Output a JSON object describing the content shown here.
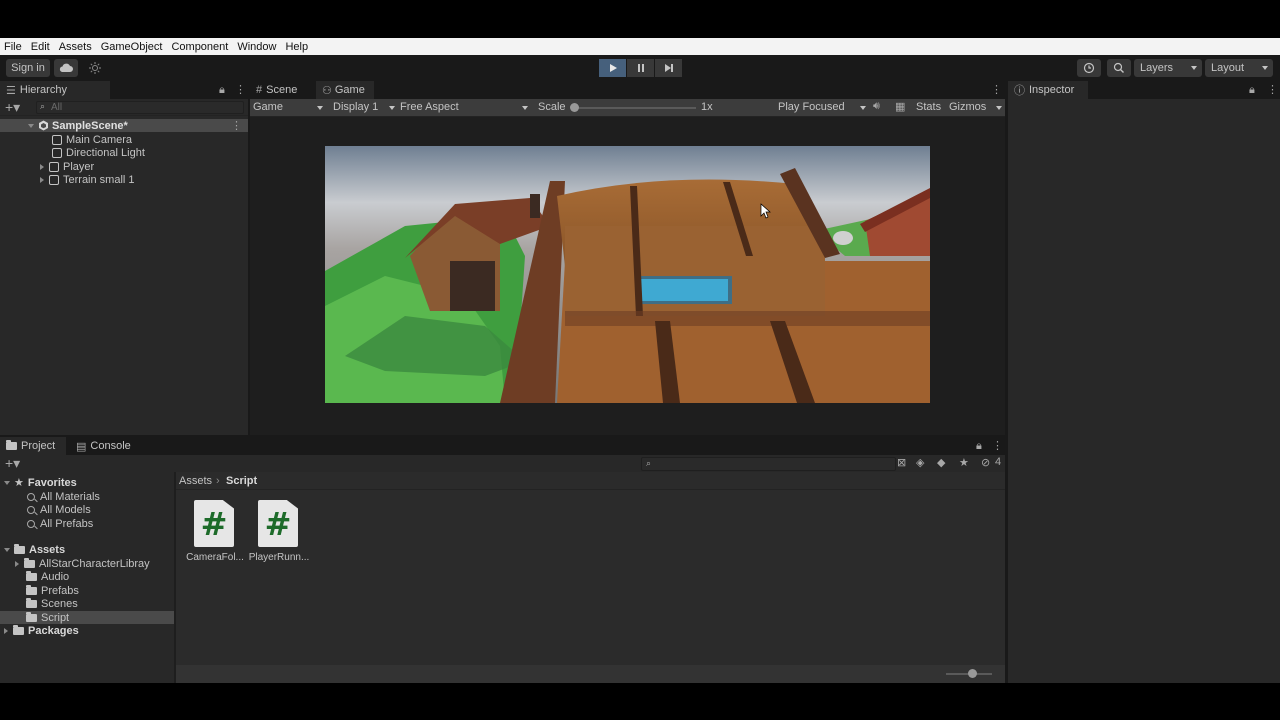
{
  "menu": [
    "File",
    "Edit",
    "Assets",
    "GameObject",
    "Component",
    "Window",
    "Help"
  ],
  "toolbar": {
    "sign_in": "Sign in",
    "layers": "Layers",
    "layout": "Layout",
    "play_state": "playing"
  },
  "hierarchy": {
    "tab": "Hierarchy",
    "search_placeholder": "All",
    "scene": "SampleScene*",
    "items": [
      "Main Camera",
      "Directional Light",
      "Player",
      "Terrain small 1"
    ]
  },
  "view_tabs": {
    "scene": "Scene",
    "game": "Game"
  },
  "game_bar": {
    "mode": "Game",
    "display": "Display 1",
    "aspect": "Free Aspect",
    "scale_label": "Scale",
    "scale_value": "1x",
    "play_mode": "Play Focused",
    "stats": "Stats",
    "gizmos": "Gizmos"
  },
  "inspector": {
    "tab": "Inspector"
  },
  "bottom_tabs": {
    "project": "Project",
    "console": "Console"
  },
  "project": {
    "hidden_count": "4",
    "favorites_label": "Favorites",
    "favorites": [
      "All Materials",
      "All Models",
      "All Prefabs"
    ],
    "assets_label": "Assets",
    "asset_folders": [
      "AllStarCharacterLibray",
      "Audio",
      "Prefabs",
      "Scenes",
      "Script"
    ],
    "packages_label": "Packages",
    "breadcrumb": [
      "Assets",
      "Script"
    ],
    "files": [
      {
        "name": "CameraFol...",
        "glyph": "#"
      },
      {
        "name": "PlayerRunn...",
        "glyph": "#"
      }
    ]
  },
  "colors": {
    "accent_play": "#46607c",
    "panel": "#282828",
    "background": "#191919",
    "script_icon": "#1d6b2a"
  }
}
